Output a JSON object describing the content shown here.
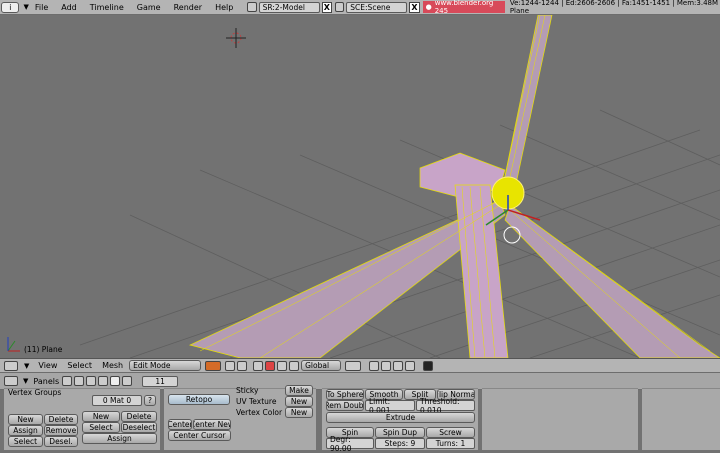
{
  "topbar": {
    "menu": [
      "File",
      "Add",
      "Timeline",
      "Game",
      "Render",
      "Help"
    ],
    "screen": "SR:2-Model",
    "scene": "SCE:Scene",
    "url": "www.blender.org 245",
    "stats": "Ve:1244-1244 | Ed:2606-2606 | Fa:1451-1451 | Mem:3.48M Plane",
    "close": "X"
  },
  "viewport": {
    "object_label": "(11) Plane"
  },
  "header3d": {
    "menu": [
      "View",
      "Select",
      "Mesh"
    ],
    "mode": "Edit Mode",
    "orientation": "Global"
  },
  "buttons_header": {
    "panels_label": "Panels",
    "frame": "11"
  },
  "buttons": {
    "vertex_groups_title": "Vertex Groups",
    "mat_field": "0 Mat 0",
    "mat_q": "?",
    "vg_new": "New",
    "vg_delete": "Delete",
    "vg_assign": "Assign",
    "vg_remove": "Remove",
    "vg_select": "Select",
    "vg_desel": "Desel.",
    "mat_new": "New",
    "mat_delete": "Delete",
    "mat_select": "Select",
    "mat_deselect": "Deselect",
    "mat_assign": "Assign",
    "retopo": "Retopo",
    "center_new": "Center New",
    "center": "Center",
    "center_cursor": "Center Cursor",
    "sticky": "Sticky",
    "uv_texture": "UV Texture",
    "vertex_color": "Vertex Color",
    "make": "Make",
    "new1": "New",
    "new2": "New",
    "to_sphere": "To Sphere",
    "smooth": "Smooth",
    "split": "Split",
    "flip_normal": "Flip Normal",
    "rem_doubles": "Rem Doubl",
    "limit": "Limit: 0.001",
    "threshold": "Threshold: 0.010",
    "extrude": "Extrude",
    "spin": "Spin",
    "spin_dup": "Spin Dup",
    "screw": "Screw",
    "degr": "Degr: 90.00",
    "steps": "Steps: 9",
    "turns": "Turns: 1"
  },
  "colors": {
    "wire": "#e8e000",
    "face": "#c8a4c8",
    "grid": "#5e5e5e",
    "url_bg": "#d84a5a"
  }
}
